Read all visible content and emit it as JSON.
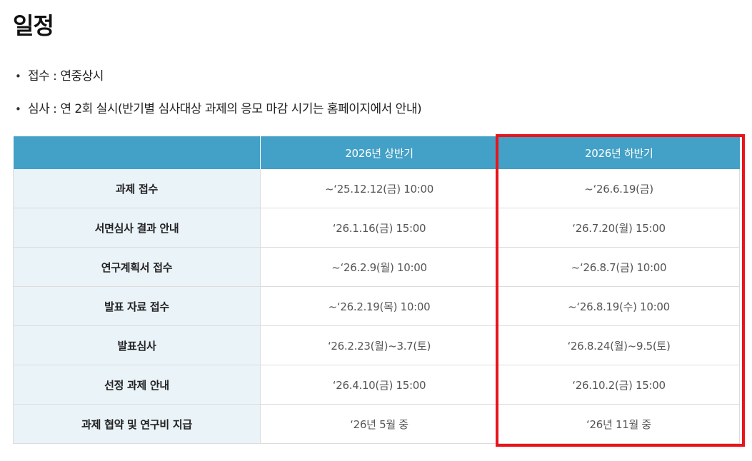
{
  "page": {
    "title": "일정"
  },
  "info": [
    {
      "text": "접수 : 연중상시"
    },
    {
      "text": "심사 : 연 2회 실시(반기별 심사대상 과제의 응모 마감 시기는 홈페이지에서 안내)"
    }
  ],
  "table": {
    "headers": [
      "",
      "2026년 상반기",
      "2026년 하반기"
    ],
    "rows": [
      {
        "label": "과제 접수",
        "first": "~‘25.12.12(금) 10:00",
        "second": "~‘26.6.19(금)"
      },
      {
        "label": "서면심사 결과 안내",
        "first": "‘26.1.16(금) 15:00",
        "second": "‘26.7.20(월) 15:00"
      },
      {
        "label": "연구계획서 접수",
        "first": "~‘26.2.9(월) 10:00",
        "second": "~‘26.8.7(금) 10:00"
      },
      {
        "label": "발표 자료 접수",
        "first": "~‘26.2.19(목) 10:00",
        "second": "~‘26.8.19(수) 10:00"
      },
      {
        "label": "발표심사",
        "first": "‘26.2.23(월)~3.7(토)",
        "second": "‘26.8.24(월)~9.5(토)"
      },
      {
        "label": "선정 과제 안내",
        "first": "‘26.4.10(금) 15:00",
        "second": "‘26.10.2(금) 15:00"
      },
      {
        "label": "과제 협약 및 연구비 지급",
        "first": "‘26년 5월 중",
        "second": "‘26년 11월 중"
      }
    ]
  },
  "colors": {
    "header_bg": "#43a0c6",
    "label_bg": "#eaf3f8",
    "highlight": "#e8151b"
  }
}
